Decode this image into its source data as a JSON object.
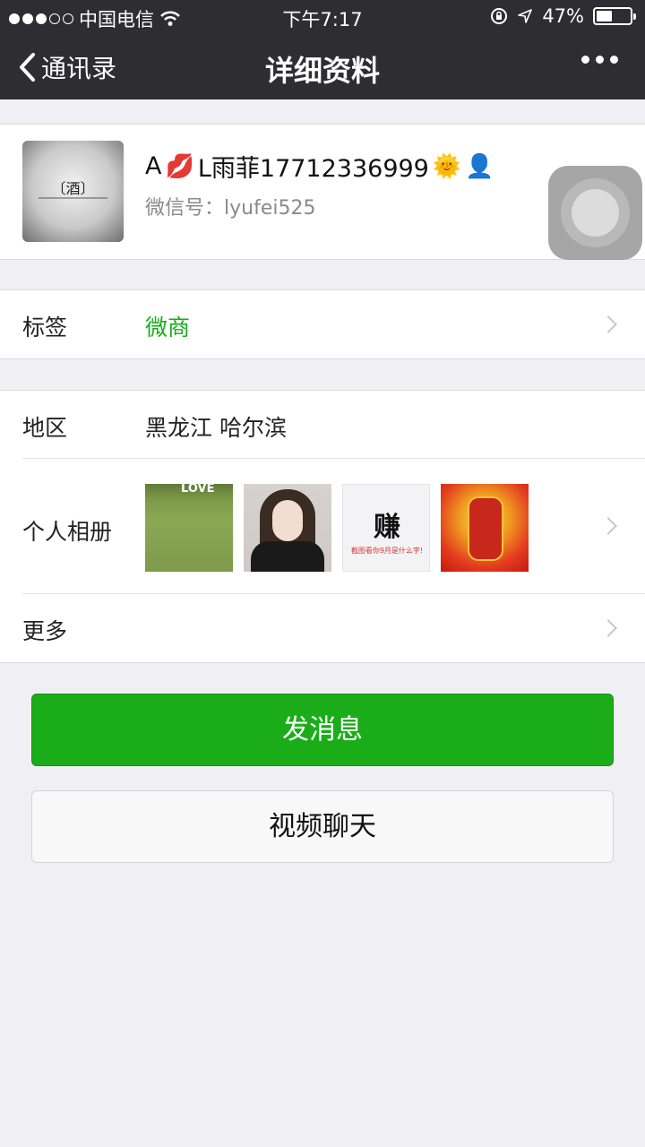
{
  "status_bar": {
    "carrier": "中国电信",
    "time": "下午7:17",
    "battery": "47%",
    "battery_level": 0.47
  },
  "nav": {
    "back_label": "通讯录",
    "title": "详细资料"
  },
  "profile": {
    "avatar_text": "〔酒〕",
    "name_prefix": "A",
    "name_emoji_1": "💋",
    "name_main": "L雨菲17712336999",
    "name_emoji_2": "🌞",
    "name_emoji_3": "👤",
    "wechat_id": "微信号：lyufei525"
  },
  "tags": {
    "label": "标签",
    "value": "微商"
  },
  "region": {
    "label": "地区",
    "value": "黑龙江 哈尔滨"
  },
  "album": {
    "label": "个人相册",
    "thumb1_text": "LOVE",
    "thumb3_big": "赚",
    "thumb3_small": "截图看你9月是什么字!"
  },
  "more": {
    "label": "更多"
  },
  "buttons": {
    "send_message": "发消息",
    "video_call": "视频聊天"
  },
  "colors": {
    "accent_green": "#1aad19",
    "nav_bg": "#2e2e32",
    "page_bg": "#efeff4"
  }
}
